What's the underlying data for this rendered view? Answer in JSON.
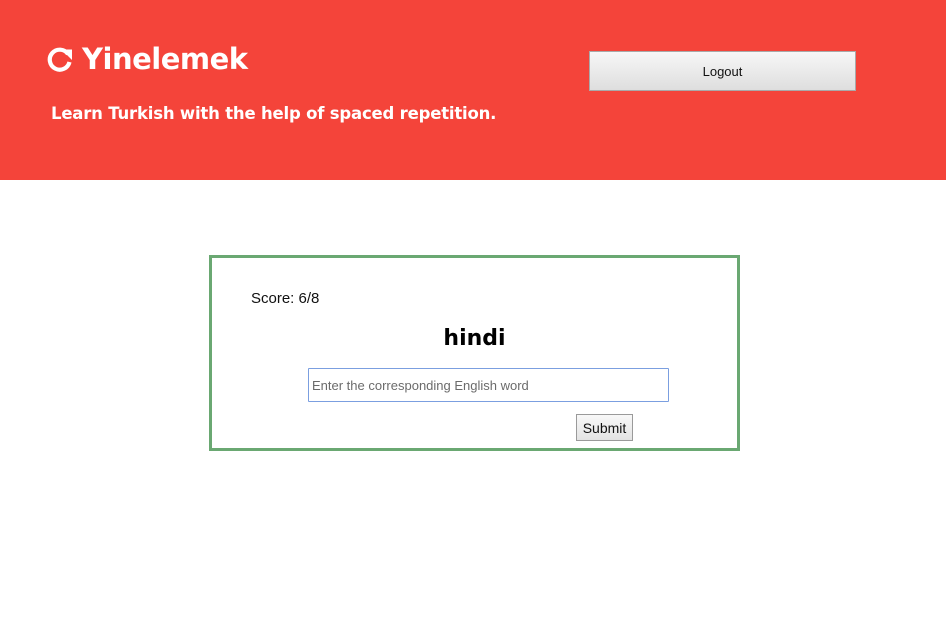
{
  "header": {
    "app_title": "Yinelemek",
    "tagline": "Learn Turkish with the help of spaced repetition.",
    "logo_icon": "refresh-icon",
    "logout_label": "Logout",
    "background_color": "#f4443a"
  },
  "quiz": {
    "score_text": "Score: 6/8",
    "word": "hindi",
    "answer_value": "",
    "answer_placeholder": "Enter the corresponding English word",
    "submit_label": "Submit",
    "border_color": "#6aa872"
  }
}
